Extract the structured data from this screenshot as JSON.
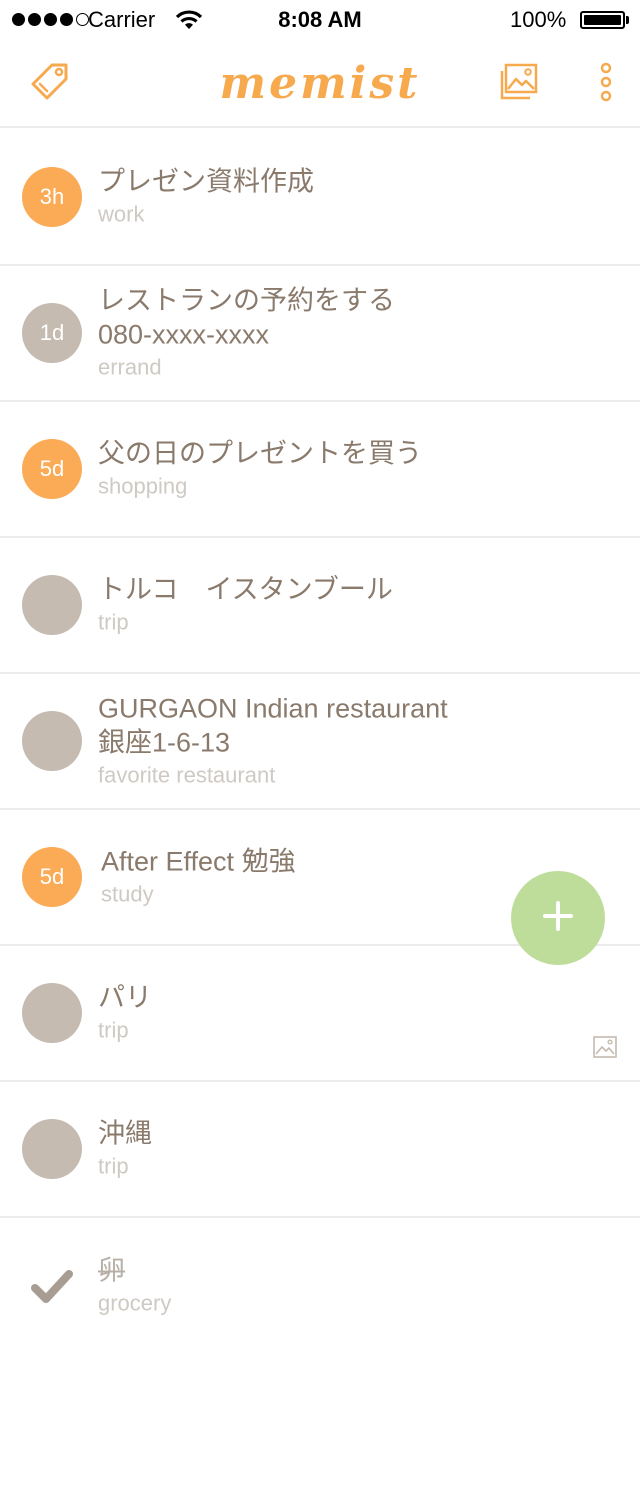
{
  "status_bar": {
    "carrier": "Carrier",
    "time": "8:08 AM",
    "battery": "100%"
  },
  "header": {
    "logo": "memist",
    "tag_icon": "tag-icon",
    "gallery_icon": "image-gallery-icon",
    "more_icon": "more-vertical-icon"
  },
  "colors": {
    "accent": "#f7a94e",
    "badge_orange": "#fbaa55",
    "badge_gray": "#c5bbb1",
    "fab": "#bedd9a",
    "text": "#8a7a6c",
    "subtext": "#cfc9c3"
  },
  "memos": [
    {
      "badge": "3h",
      "title": "プレゼン資料作成",
      "title2": "",
      "tag": "work"
    },
    {
      "badge": "1d",
      "title": "レストランの予約をする",
      "title2": "080-xxxx-xxxx",
      "tag": "errand"
    },
    {
      "badge": "5d",
      "title": "父の日のプレゼントを買う",
      "title2": "",
      "tag": "shopping"
    },
    {
      "badge": "",
      "title": "トルコ　イスタンブール",
      "title2": "",
      "tag": "trip"
    },
    {
      "badge": "",
      "title": "GURGAON Indian restaurant",
      "title2": "銀座1-6-13",
      "tag": "favorite restaurant"
    },
    {
      "badge": "5d",
      "title": "After Effect 勉強",
      "title2": "",
      "tag": "study"
    },
    {
      "badge": "",
      "title": "パリ",
      "title2": "",
      "tag": "trip"
    },
    {
      "badge": "",
      "title": "沖縄",
      "title2": "",
      "tag": "trip"
    },
    {
      "badge": "",
      "title": "卵",
      "title2": "",
      "tag": "grocery"
    }
  ],
  "fab": {
    "icon": "plus-icon"
  }
}
